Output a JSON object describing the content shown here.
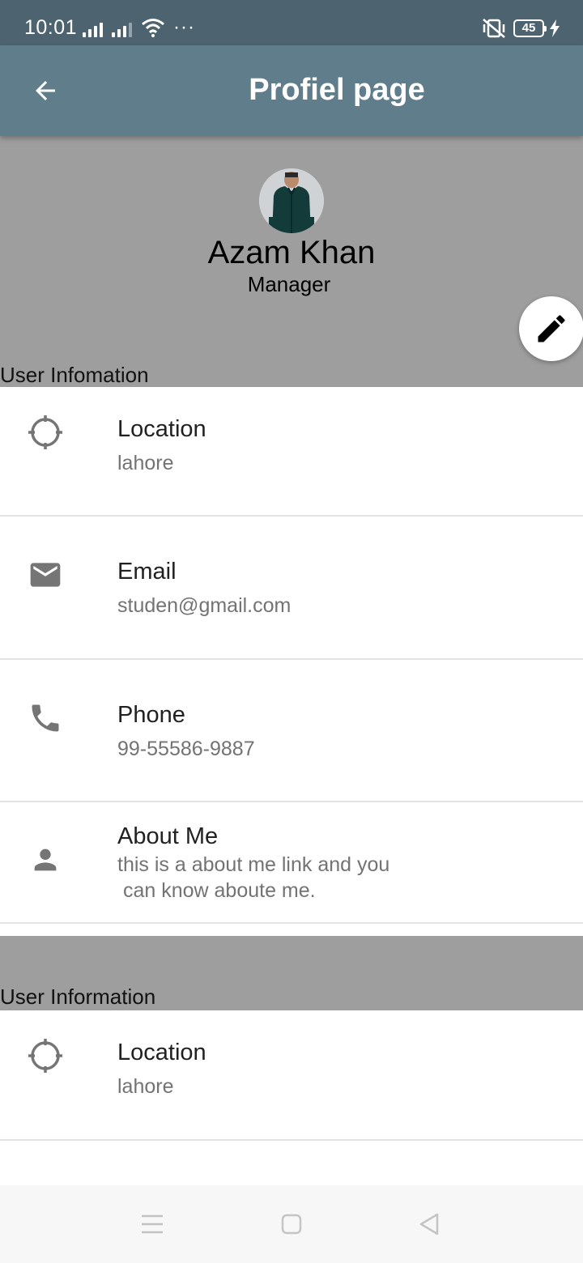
{
  "status_bar": {
    "time": "10:01",
    "overflow": "···",
    "battery_level": "45",
    "icons": [
      "signal-icon",
      "signal-icon",
      "wifi-icon",
      "vibrate-mute-icon",
      "battery-icon",
      "charging-icon"
    ]
  },
  "app_bar": {
    "title": "Profiel page",
    "back_icon": "arrow-back-icon"
  },
  "profile": {
    "name": "Azam Khan",
    "role": "Manager",
    "section_label": "User Infomation",
    "edit_icon": "edit-pencil-icon"
  },
  "info_rows": [
    {
      "icon": "crosshair-icon",
      "title": "Location",
      "value": "lahore"
    },
    {
      "icon": "email-icon",
      "title": "Email",
      "value": "studen@gmail.com"
    },
    {
      "icon": "phone-icon",
      "title": "Phone",
      "value": "99-55586-9887"
    },
    {
      "icon": "person-icon",
      "title": "About Me",
      "value": "this is a about me link and you\n can know aboute me."
    }
  ],
  "second_section": {
    "label": "User Information",
    "rows": [
      {
        "icon": "crosshair-icon",
        "title": "Location",
        "value": "lahore"
      }
    ]
  },
  "colors": {
    "status_bar": "#4d6470",
    "app_bar": "#607d8b",
    "header_bg": "#9e9e9e",
    "icon_grey": "#757575"
  }
}
